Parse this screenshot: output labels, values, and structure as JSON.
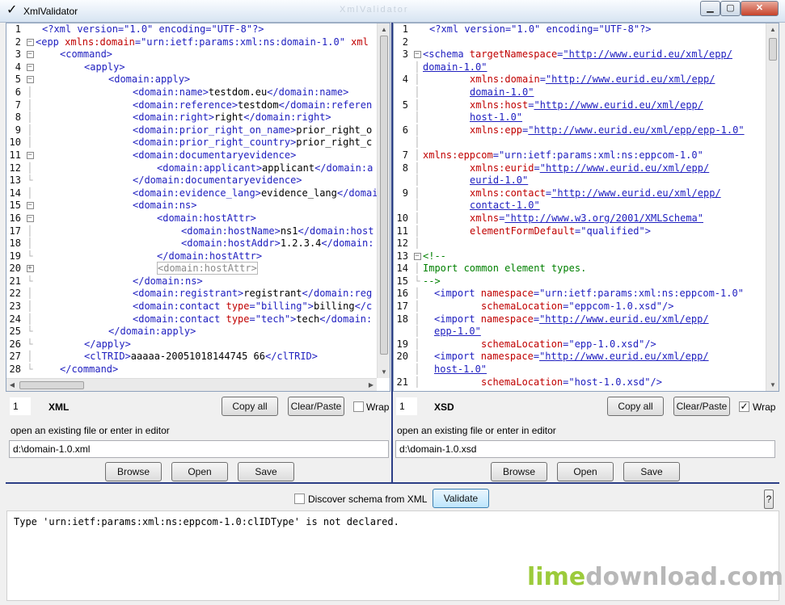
{
  "window": {
    "title": "XmlValidator",
    "ghost_text": "XmlValidator"
  },
  "titlebar_buttons": {
    "minimize": "▁",
    "maximize": "▢",
    "close": "✕"
  },
  "colors": {
    "tag": "#2020c0",
    "text": "#000000",
    "attr_name": "#c00000",
    "attr_value": "#2020c0",
    "url": "#2020c0",
    "comment": "#008000",
    "accent_divider": "#2c3e86",
    "watermark_lime": "#9ccb3b",
    "watermark_gray": "#b8b8b8"
  },
  "xml_editor": {
    "lines": [
      {
        "n": "1",
        "fold": "",
        "ind": 8,
        "seg": [
          [
            "t",
            "<?xml version=\"1.0\" encoding=\"UTF-8\"?>"
          ]
        ]
      },
      {
        "n": "2",
        "fold": "minus",
        "ind": 0,
        "seg": [
          [
            "t",
            "<epp "
          ],
          [
            "a",
            "xmlns:domain"
          ],
          [
            "t",
            "="
          ],
          [
            "v",
            "\"urn:ietf:params:xml:ns:domain-1.0\""
          ],
          [
            "t",
            " "
          ],
          [
            "a",
            "xml"
          ]
        ]
      },
      {
        "n": "3",
        "fold": "minus",
        "ind": 30,
        "seg": [
          [
            "t",
            "<command>"
          ]
        ]
      },
      {
        "n": "4",
        "fold": "minus",
        "ind": 60,
        "seg": [
          [
            "t",
            "<apply>"
          ]
        ]
      },
      {
        "n": "5",
        "fold": "minus",
        "ind": 90,
        "seg": [
          [
            "t",
            "<domain:apply>"
          ]
        ]
      },
      {
        "n": "6",
        "fold": "line",
        "ind": 120,
        "seg": [
          [
            "t",
            "<domain:name>"
          ],
          [
            "x",
            "testdom.eu"
          ],
          [
            "t",
            "</domain:name>"
          ]
        ]
      },
      {
        "n": "7",
        "fold": "line",
        "ind": 120,
        "seg": [
          [
            "t",
            "<domain:reference>"
          ],
          [
            "x",
            "testdom"
          ],
          [
            "t",
            "</domain:referen"
          ]
        ]
      },
      {
        "n": "8",
        "fold": "line",
        "ind": 120,
        "seg": [
          [
            "t",
            "<domain:right>"
          ],
          [
            "x",
            "right"
          ],
          [
            "t",
            "</domain:right>"
          ]
        ]
      },
      {
        "n": "9",
        "fold": "line",
        "ind": 120,
        "seg": [
          [
            "t",
            "<domain:prior_right_on_name>"
          ],
          [
            "x",
            "prior_right_o"
          ]
        ]
      },
      {
        "n": "10",
        "fold": "line",
        "ind": 120,
        "seg": [
          [
            "t",
            "<domain:prior_right_country>"
          ],
          [
            "x",
            "prior_right_c"
          ]
        ]
      },
      {
        "n": "11",
        "fold": "minus",
        "ind": 120,
        "seg": [
          [
            "t",
            "<domain:documentaryevidence>"
          ]
        ]
      },
      {
        "n": "12",
        "fold": "line",
        "ind": 150,
        "seg": [
          [
            "t",
            "<domain:applicant>"
          ],
          [
            "x",
            "applicant"
          ],
          [
            "t",
            "</domain:a"
          ]
        ]
      },
      {
        "n": "13",
        "fold": "end",
        "ind": 120,
        "seg": [
          [
            "t",
            "</domain:documentaryevidence>"
          ]
        ]
      },
      {
        "n": "14",
        "fold": "line",
        "ind": 120,
        "seg": [
          [
            "t",
            "<domain:evidence_lang>"
          ],
          [
            "x",
            "evidence_lang"
          ],
          [
            "t",
            "</domai"
          ]
        ]
      },
      {
        "n": "15",
        "fold": "minus",
        "ind": 120,
        "seg": [
          [
            "t",
            "<domain:ns>"
          ]
        ]
      },
      {
        "n": "16",
        "fold": "minus",
        "ind": 150,
        "seg": [
          [
            "t",
            "<domain:hostAttr>"
          ]
        ]
      },
      {
        "n": "17",
        "fold": "line",
        "ind": 180,
        "seg": [
          [
            "t",
            "<domain:hostName>"
          ],
          [
            "x",
            "ns1"
          ],
          [
            "t",
            "</domain:host"
          ]
        ]
      },
      {
        "n": "18",
        "fold": "line",
        "ind": 180,
        "seg": [
          [
            "t",
            "<domain:hostAddr>"
          ],
          [
            "x",
            "1.2.3.4"
          ],
          [
            "t",
            "</domain:"
          ]
        ]
      },
      {
        "n": "19",
        "fold": "end",
        "ind": 150,
        "seg": [
          [
            "t",
            "</domain:hostAttr>"
          ]
        ]
      },
      {
        "n": "20",
        "fold": "plus",
        "ind": 150,
        "seg": [
          [
            "h",
            "<domain:hostAttr>"
          ]
        ]
      },
      {
        "n": "21",
        "fold": "end",
        "ind": 120,
        "seg": [
          [
            "t",
            "</domain:ns>"
          ]
        ]
      },
      {
        "n": "22",
        "fold": "line",
        "ind": 120,
        "seg": [
          [
            "t",
            "<domain:registrant>"
          ],
          [
            "x",
            "registrant"
          ],
          [
            "t",
            "</domain:reg"
          ]
        ]
      },
      {
        "n": "23",
        "fold": "line",
        "ind": 120,
        "seg": [
          [
            "t",
            "<domain:contact "
          ],
          [
            "a",
            "type"
          ],
          [
            "t",
            "="
          ],
          [
            "v",
            "\"billing\""
          ],
          [
            "t",
            ">"
          ],
          [
            "x",
            "billing"
          ],
          [
            "t",
            "</c"
          ]
        ]
      },
      {
        "n": "24",
        "fold": "line",
        "ind": 120,
        "seg": [
          [
            "t",
            "<domain:contact "
          ],
          [
            "a",
            "type"
          ],
          [
            "t",
            "="
          ],
          [
            "v",
            "\"tech\""
          ],
          [
            "t",
            ">"
          ],
          [
            "x",
            "tech"
          ],
          [
            "t",
            "</domain:"
          ]
        ]
      },
      {
        "n": "25",
        "fold": "end",
        "ind": 90,
        "seg": [
          [
            "t",
            "</domain:apply>"
          ]
        ]
      },
      {
        "n": "26",
        "fold": "end",
        "ind": 60,
        "seg": [
          [
            "t",
            "</apply>"
          ]
        ]
      },
      {
        "n": "27",
        "fold": "line",
        "ind": 60,
        "seg": [
          [
            "t",
            "<clTRID>"
          ],
          [
            "x",
            "aaaaa-20051018144745 66"
          ],
          [
            "t",
            "</clTRID>"
          ]
        ]
      },
      {
        "n": "28",
        "fold": "end",
        "ind": 30,
        "seg": [
          [
            "t",
            "</command>"
          ]
        ]
      }
    ]
  },
  "xsd_editor": {
    "lines": [
      {
        "n": "1",
        "fold": "",
        "ind": 8,
        "seg": [
          [
            "t",
            "<?xml version=\"1.0\" encoding=\"UTF-8\"?>"
          ]
        ]
      },
      {
        "n": "2",
        "fold": "",
        "ind": 0,
        "seg": []
      },
      {
        "n": "3",
        "fold": "minus",
        "ind": 0,
        "seg": [
          [
            "t",
            "<schema "
          ],
          [
            "a",
            "targetNamespace"
          ],
          [
            "t",
            "="
          ],
          [
            "u",
            "\"http://www.eurid.eu/xml/epp/"
          ]
        ]
      },
      {
        "n": "",
        "fold": "line",
        "ind": 0,
        "seg": [
          [
            "u",
            "domain-1.0\""
          ]
        ]
      },
      {
        "n": "4",
        "fold": "line",
        "ind": 58,
        "seg": [
          [
            "a",
            "xmlns:domain"
          ],
          [
            "t",
            "="
          ],
          [
            "u",
            "\"http://www.eurid.eu/xml/epp/"
          ]
        ]
      },
      {
        "n": "",
        "fold": "line",
        "ind": 58,
        "seg": [
          [
            "u",
            "domain-1.0\""
          ]
        ]
      },
      {
        "n": "5",
        "fold": "line",
        "ind": 58,
        "seg": [
          [
            "a",
            "xmlns:host"
          ],
          [
            "t",
            "="
          ],
          [
            "u",
            "\"http://www.eurid.eu/xml/epp/"
          ]
        ]
      },
      {
        "n": "",
        "fold": "line",
        "ind": 58,
        "seg": [
          [
            "u",
            "host-1.0\""
          ]
        ]
      },
      {
        "n": "6",
        "fold": "line",
        "ind": 58,
        "seg": [
          [
            "a",
            "xmlns:epp"
          ],
          [
            "t",
            "="
          ],
          [
            "u",
            "\"http://www.eurid.eu/xml/epp/epp-1.0\""
          ]
        ]
      },
      {
        "n": "",
        "fold": "line",
        "ind": 0,
        "seg": []
      },
      {
        "n": "7",
        "fold": "line",
        "ind": 0,
        "seg": [
          [
            "a",
            "xmlns:eppcom"
          ],
          [
            "t",
            "="
          ],
          [
            "v",
            "\"urn:ietf:params:xml:ns:eppcom-1.0\""
          ]
        ]
      },
      {
        "n": "8",
        "fold": "line",
        "ind": 58,
        "seg": [
          [
            "a",
            "xmlns:eurid"
          ],
          [
            "t",
            "="
          ],
          [
            "u",
            "\"http://www.eurid.eu/xml/epp/"
          ]
        ]
      },
      {
        "n": "",
        "fold": "line",
        "ind": 58,
        "seg": [
          [
            "u",
            "eurid-1.0\""
          ]
        ]
      },
      {
        "n": "9",
        "fold": "line",
        "ind": 58,
        "seg": [
          [
            "a",
            "xmlns:contact"
          ],
          [
            "t",
            "="
          ],
          [
            "u",
            "\"http://www.eurid.eu/xml/epp/"
          ]
        ]
      },
      {
        "n": "",
        "fold": "line",
        "ind": 58,
        "seg": [
          [
            "u",
            "contact-1.0\""
          ]
        ]
      },
      {
        "n": "10",
        "fold": "line",
        "ind": 58,
        "seg": [
          [
            "a",
            "xmlns"
          ],
          [
            "t",
            "="
          ],
          [
            "u",
            "\"http://www.w3.org/2001/XMLSchema\""
          ]
        ]
      },
      {
        "n": "11",
        "fold": "line",
        "ind": 58,
        "seg": [
          [
            "a",
            "elementFormDefault"
          ],
          [
            "t",
            "="
          ],
          [
            "v",
            "\"qualified\""
          ],
          [
            "t",
            ">"
          ]
        ]
      },
      {
        "n": "12",
        "fold": "line",
        "ind": 0,
        "seg": []
      },
      {
        "n": "13",
        "fold": "minus",
        "ind": 0,
        "seg": [
          [
            "c",
            "<!--"
          ]
        ]
      },
      {
        "n": "14",
        "fold": "line",
        "ind": 0,
        "seg": [
          [
            "c",
            "Import common element types."
          ]
        ]
      },
      {
        "n": "15",
        "fold": "end",
        "ind": 0,
        "seg": [
          [
            "c",
            "-->"
          ]
        ]
      },
      {
        "n": "16",
        "fold": "line",
        "ind": 14,
        "seg": [
          [
            "t",
            "<import "
          ],
          [
            "a",
            "namespace"
          ],
          [
            "t",
            "="
          ],
          [
            "v",
            "\"urn:ietf:params:xml:ns:eppcom-1.0\""
          ]
        ]
      },
      {
        "n": "17",
        "fold": "line",
        "ind": 72,
        "seg": [
          [
            "a",
            "schemaLocation"
          ],
          [
            "t",
            "="
          ],
          [
            "v",
            "\"eppcom-1.0.xsd\""
          ],
          [
            "t",
            "/>"
          ]
        ]
      },
      {
        "n": "18",
        "fold": "line",
        "ind": 14,
        "seg": [
          [
            "t",
            "<import "
          ],
          [
            "a",
            "namespace"
          ],
          [
            "t",
            "="
          ],
          [
            "u",
            "\"http://www.eurid.eu/xml/epp/"
          ]
        ]
      },
      {
        "n": "",
        "fold": "line",
        "ind": 14,
        "seg": [
          [
            "u",
            "epp-1.0\""
          ]
        ]
      },
      {
        "n": "19",
        "fold": "line",
        "ind": 72,
        "seg": [
          [
            "a",
            "schemaLocation"
          ],
          [
            "t",
            "="
          ],
          [
            "v",
            "\"epp-1.0.xsd\""
          ],
          [
            "t",
            "/>"
          ]
        ]
      },
      {
        "n": "20",
        "fold": "line",
        "ind": 14,
        "seg": [
          [
            "t",
            "<import "
          ],
          [
            "a",
            "namespace"
          ],
          [
            "t",
            "="
          ],
          [
            "u",
            "\"http://www.eurid.eu/xml/epp/"
          ]
        ]
      },
      {
        "n": "",
        "fold": "line",
        "ind": 14,
        "seg": [
          [
            "u",
            "host-1.0\""
          ]
        ]
      },
      {
        "n": "21",
        "fold": "line",
        "ind": 72,
        "seg": [
          [
            "a",
            "schemaLocation"
          ],
          [
            "t",
            "="
          ],
          [
            "v",
            "\"host-1.0.xsd\""
          ],
          [
            "t",
            "/>"
          ]
        ]
      }
    ]
  },
  "xml_panel": {
    "line_no": "1",
    "lang": "XML",
    "copy_all": "Copy all",
    "clear_paste": "Clear/Paste",
    "wrap_label": "Wrap",
    "wrap_checked": false,
    "hint": "open an existing file or enter in editor",
    "path": "d:\\domain-1.0.xml",
    "browse": "Browse",
    "open": "Open",
    "save": "Save"
  },
  "xsd_panel": {
    "line_no": "1",
    "lang": "XSD",
    "copy_all": "Copy all",
    "clear_paste": "Clear/Paste",
    "wrap_label": "Wrap",
    "wrap_checked": true,
    "hint": "open an existing file or enter in editor",
    "path": "d:\\domain-1.0.xsd",
    "browse": "Browse",
    "open": "Open",
    "save": "Save"
  },
  "validate_bar": {
    "discover_label": "Discover schema from XML",
    "discover_checked": false,
    "validate": "Validate",
    "help": "?"
  },
  "output": {
    "message": "Type 'urn:ietf:params:xml:ns:eppcom-1.0:clIDType' is not declared."
  },
  "watermark": {
    "part1": "lime",
    "part2": "download.com"
  }
}
